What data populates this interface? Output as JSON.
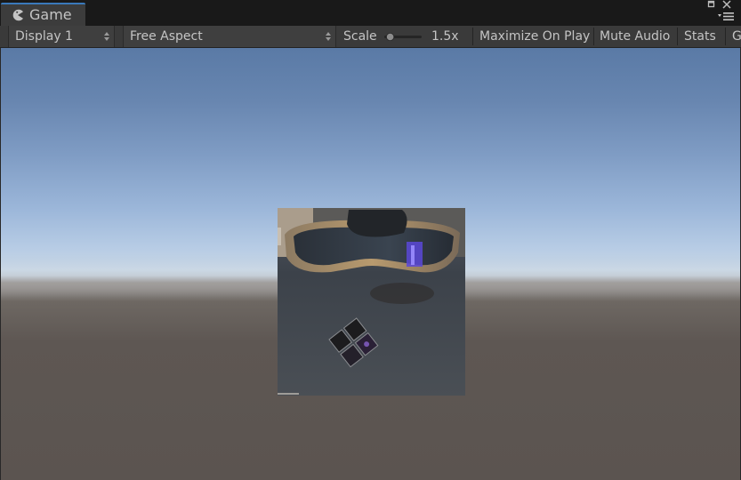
{
  "window": {
    "tab_label": "Game",
    "tab_icon": "pacman-icon"
  },
  "toolbar": {
    "display": {
      "label": "Display 1",
      "icon": "up-down-arrows-icon"
    },
    "aspect": {
      "label": "Free Aspect",
      "icon": "up-down-arrows-icon"
    },
    "scale": {
      "label": "Scale",
      "value_text": "1.5x",
      "slider_fraction": 0.1
    },
    "maximize_on_play": "Maximize On Play",
    "mute_audio": "Mute Audio",
    "stats": "Stats",
    "gizmos_clipped": "G"
  },
  "colors": {
    "tab_accent": "#3a79bb",
    "toolbar_bg": "#3a3a3a",
    "text": "#c4c4c4",
    "sky_top": "#5a7aa6",
    "horizon": "#c8d6e4",
    "ground": "#5b5450"
  },
  "scene": {
    "textured_quad": "photo-quad"
  }
}
